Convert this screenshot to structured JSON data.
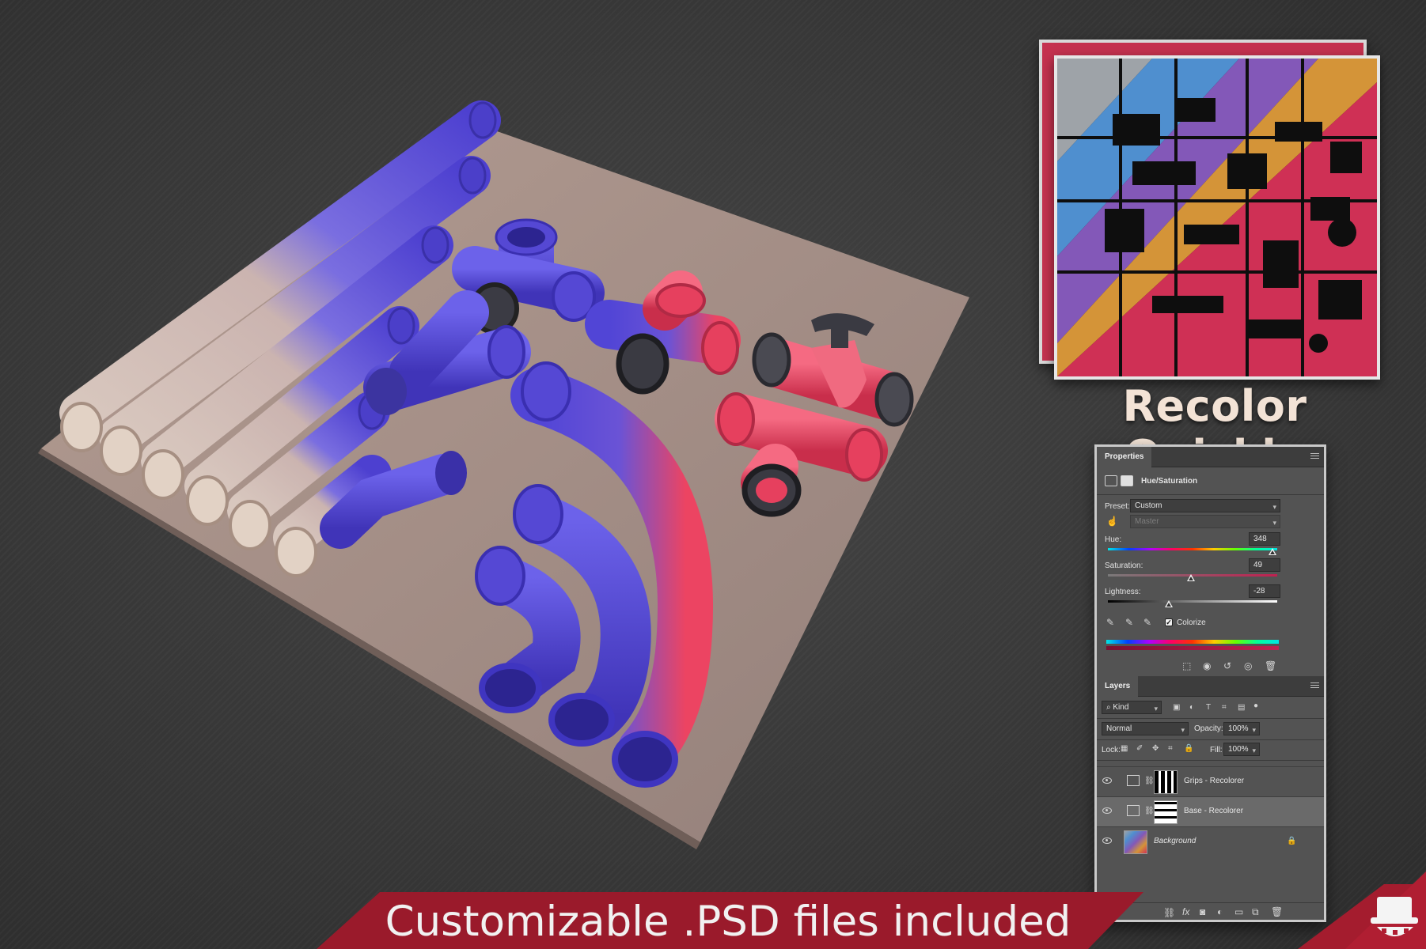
{
  "headline": "Recolor Quickly",
  "banner": {
    "text": "Customizable .PSD files included"
  },
  "colors": {
    "background": "#3b3b3b",
    "banner_red": "#9c1b2c",
    "pipe_blue": "#5a4fd6",
    "pipe_red": "#e6425e",
    "pipe_beige": "#c9b3a8",
    "mat_tan": "#a58e84"
  },
  "properties_panel": {
    "tab": "Properties",
    "adjustment_title": "Hue/Saturation",
    "preset_label": "Preset:",
    "preset_value": "Custom",
    "channel_value": "Master",
    "hue_label": "Hue:",
    "hue_value": "348",
    "saturation_label": "Saturation:",
    "saturation_value": "49",
    "lightness_label": "Lightness:",
    "lightness_value": "-28",
    "colorize_label": "Colorize",
    "colorize_checked": true,
    "sliders": {
      "hue_fraction": 0.97,
      "saturation_fraction": 0.49,
      "lightness_fraction": 0.36
    }
  },
  "layers_panel": {
    "tab": "Layers",
    "filter_value": "Kind",
    "blend_mode": "Normal",
    "opacity_label": "Opacity:",
    "opacity_value": "100%",
    "lock_label": "Lock:",
    "fill_label": "Fill:",
    "fill_value": "100%",
    "layers": [
      {
        "name": "Grips - Recolorer",
        "selected": false
      },
      {
        "name": "Base - Recolorer",
        "selected": true
      },
      {
        "name": "Background",
        "selected": false,
        "locked": true
      }
    ]
  },
  "icons": [
    "eye-icon",
    "lock-icon",
    "trash-icon",
    "eyedropper-icon",
    "link-icon",
    "fx-icon",
    "folder-icon",
    "new-layer-icon",
    "mask-icon",
    "hand-target-icon",
    "reset-icon",
    "clip-icon",
    "top-hat-logo-icon"
  ]
}
